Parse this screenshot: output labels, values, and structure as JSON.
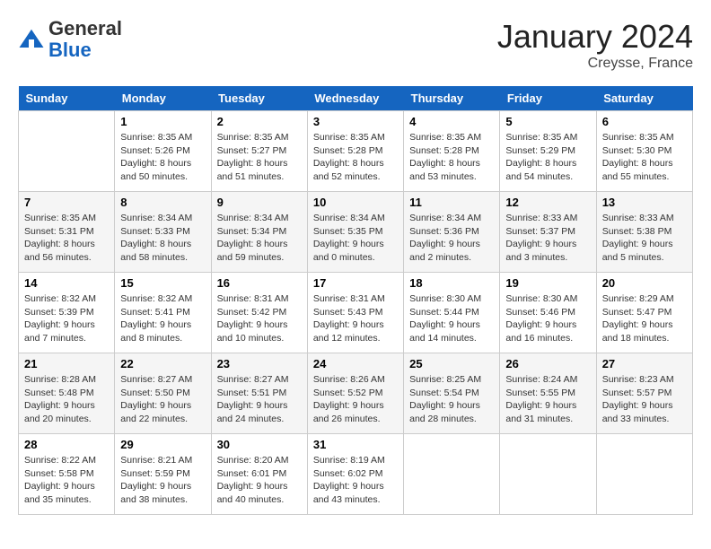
{
  "header": {
    "logo_general": "General",
    "logo_blue": "Blue",
    "month_year": "January 2024",
    "location": "Creysse, France"
  },
  "weekdays": [
    "Sunday",
    "Monday",
    "Tuesday",
    "Wednesday",
    "Thursday",
    "Friday",
    "Saturday"
  ],
  "weeks": [
    [
      {
        "day": "",
        "info": ""
      },
      {
        "day": "1",
        "info": "Sunrise: 8:35 AM\nSunset: 5:26 PM\nDaylight: 8 hours\nand 50 minutes."
      },
      {
        "day": "2",
        "info": "Sunrise: 8:35 AM\nSunset: 5:27 PM\nDaylight: 8 hours\nand 51 minutes."
      },
      {
        "day": "3",
        "info": "Sunrise: 8:35 AM\nSunset: 5:28 PM\nDaylight: 8 hours\nand 52 minutes."
      },
      {
        "day": "4",
        "info": "Sunrise: 8:35 AM\nSunset: 5:28 PM\nDaylight: 8 hours\nand 53 minutes."
      },
      {
        "day": "5",
        "info": "Sunrise: 8:35 AM\nSunset: 5:29 PM\nDaylight: 8 hours\nand 54 minutes."
      },
      {
        "day": "6",
        "info": "Sunrise: 8:35 AM\nSunset: 5:30 PM\nDaylight: 8 hours\nand 55 minutes."
      }
    ],
    [
      {
        "day": "7",
        "info": "Sunrise: 8:35 AM\nSunset: 5:31 PM\nDaylight: 8 hours\nand 56 minutes."
      },
      {
        "day": "8",
        "info": "Sunrise: 8:34 AM\nSunset: 5:33 PM\nDaylight: 8 hours\nand 58 minutes."
      },
      {
        "day": "9",
        "info": "Sunrise: 8:34 AM\nSunset: 5:34 PM\nDaylight: 8 hours\nand 59 minutes."
      },
      {
        "day": "10",
        "info": "Sunrise: 8:34 AM\nSunset: 5:35 PM\nDaylight: 9 hours\nand 0 minutes."
      },
      {
        "day": "11",
        "info": "Sunrise: 8:34 AM\nSunset: 5:36 PM\nDaylight: 9 hours\nand 2 minutes."
      },
      {
        "day": "12",
        "info": "Sunrise: 8:33 AM\nSunset: 5:37 PM\nDaylight: 9 hours\nand 3 minutes."
      },
      {
        "day": "13",
        "info": "Sunrise: 8:33 AM\nSunset: 5:38 PM\nDaylight: 9 hours\nand 5 minutes."
      }
    ],
    [
      {
        "day": "14",
        "info": "Sunrise: 8:32 AM\nSunset: 5:39 PM\nDaylight: 9 hours\nand 7 minutes."
      },
      {
        "day": "15",
        "info": "Sunrise: 8:32 AM\nSunset: 5:41 PM\nDaylight: 9 hours\nand 8 minutes."
      },
      {
        "day": "16",
        "info": "Sunrise: 8:31 AM\nSunset: 5:42 PM\nDaylight: 9 hours\nand 10 minutes."
      },
      {
        "day": "17",
        "info": "Sunrise: 8:31 AM\nSunset: 5:43 PM\nDaylight: 9 hours\nand 12 minutes."
      },
      {
        "day": "18",
        "info": "Sunrise: 8:30 AM\nSunset: 5:44 PM\nDaylight: 9 hours\nand 14 minutes."
      },
      {
        "day": "19",
        "info": "Sunrise: 8:30 AM\nSunset: 5:46 PM\nDaylight: 9 hours\nand 16 minutes."
      },
      {
        "day": "20",
        "info": "Sunrise: 8:29 AM\nSunset: 5:47 PM\nDaylight: 9 hours\nand 18 minutes."
      }
    ],
    [
      {
        "day": "21",
        "info": "Sunrise: 8:28 AM\nSunset: 5:48 PM\nDaylight: 9 hours\nand 20 minutes."
      },
      {
        "day": "22",
        "info": "Sunrise: 8:27 AM\nSunset: 5:50 PM\nDaylight: 9 hours\nand 22 minutes."
      },
      {
        "day": "23",
        "info": "Sunrise: 8:27 AM\nSunset: 5:51 PM\nDaylight: 9 hours\nand 24 minutes."
      },
      {
        "day": "24",
        "info": "Sunrise: 8:26 AM\nSunset: 5:52 PM\nDaylight: 9 hours\nand 26 minutes."
      },
      {
        "day": "25",
        "info": "Sunrise: 8:25 AM\nSunset: 5:54 PM\nDaylight: 9 hours\nand 28 minutes."
      },
      {
        "day": "26",
        "info": "Sunrise: 8:24 AM\nSunset: 5:55 PM\nDaylight: 9 hours\nand 31 minutes."
      },
      {
        "day": "27",
        "info": "Sunrise: 8:23 AM\nSunset: 5:57 PM\nDaylight: 9 hours\nand 33 minutes."
      }
    ],
    [
      {
        "day": "28",
        "info": "Sunrise: 8:22 AM\nSunset: 5:58 PM\nDaylight: 9 hours\nand 35 minutes."
      },
      {
        "day": "29",
        "info": "Sunrise: 8:21 AM\nSunset: 5:59 PM\nDaylight: 9 hours\nand 38 minutes."
      },
      {
        "day": "30",
        "info": "Sunrise: 8:20 AM\nSunset: 6:01 PM\nDaylight: 9 hours\nand 40 minutes."
      },
      {
        "day": "31",
        "info": "Sunrise: 8:19 AM\nSunset: 6:02 PM\nDaylight: 9 hours\nand 43 minutes."
      },
      {
        "day": "",
        "info": ""
      },
      {
        "day": "",
        "info": ""
      },
      {
        "day": "",
        "info": ""
      }
    ]
  ]
}
